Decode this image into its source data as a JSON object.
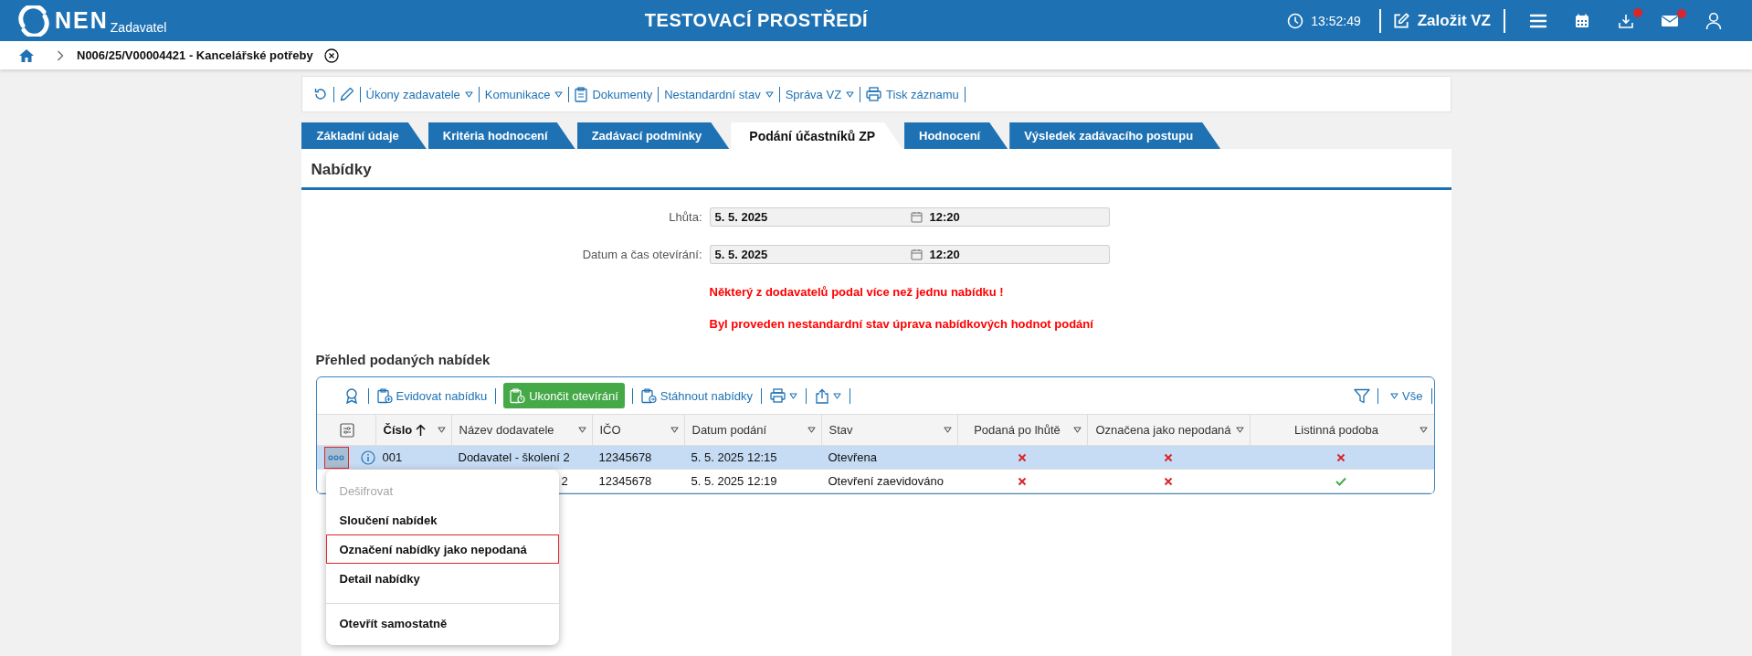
{
  "header": {
    "logo": "NEN",
    "logo_subtitle": "Zadavatel",
    "environment": "TESTOVACÍ PROSTŘEDÍ",
    "clock": "13:52:49",
    "create_button": "Založit VZ",
    "icons": [
      {
        "kind": "menu",
        "badge": false
      },
      {
        "kind": "calendar",
        "badge": false
      },
      {
        "kind": "download",
        "badge": true
      },
      {
        "kind": "mail",
        "badge": true
      },
      {
        "kind": "user",
        "badge": false
      }
    ]
  },
  "breadcrumb": {
    "title": "N006/25/V00004421 - Kancelářské potřeby"
  },
  "toolbar": [
    {
      "kind": "refresh",
      "dropdown": false
    },
    {
      "kind": "edit",
      "dropdown": false
    },
    {
      "kind": "text",
      "label": "Úkony zadavatele",
      "dropdown": true
    },
    {
      "kind": "text",
      "label": "Komunikace",
      "dropdown": true
    },
    {
      "kind": "documents",
      "label": "Dokumenty",
      "dropdown": false
    },
    {
      "kind": "text",
      "label": "Nestandardní stav",
      "dropdown": true
    },
    {
      "kind": "text",
      "label": "Správa VZ",
      "dropdown": true
    },
    {
      "kind": "print",
      "label": "Tisk záznamu",
      "dropdown": false
    }
  ],
  "tabs": [
    {
      "label": "Základní údaje",
      "selected": false
    },
    {
      "label": "Kritéria hodnocení",
      "selected": false
    },
    {
      "label": "Zadávací podmínky",
      "selected": false
    },
    {
      "label": "Podání účastníků ZP",
      "selected": true
    },
    {
      "label": "Hodnocení",
      "selected": false
    },
    {
      "label": "Výsledek zadávacího postupu",
      "selected": false
    }
  ],
  "section_title": "Nabídky",
  "fields": [
    {
      "label": "Lhůta:",
      "date": "5. 5. 2025",
      "time": "12:20"
    },
    {
      "label": "Datum a čas otevírání:",
      "date": "5. 5. 2025",
      "time": "12:20"
    }
  ],
  "messages": [
    "Některý z dodavatelů podal více než jednu nabídku !",
    "Byl proveden nestandardní stav úprava nabídkových hodnot podání"
  ],
  "offers": {
    "title": "Přehled podaných nabídek",
    "filter_label": "Vše",
    "toolbar": [
      {
        "kind": "award",
        "dropdown": false
      },
      {
        "kind": "register",
        "label": "Evidovat nabídku",
        "dropdown": false
      },
      {
        "kind": "primary",
        "label": "Ukončit otevírání",
        "dropdown": false
      },
      {
        "kind": "download",
        "label": "Stáhnout nabídky",
        "dropdown": false
      },
      {
        "kind": "print",
        "dropdown": true
      },
      {
        "kind": "export",
        "dropdown": true
      }
    ],
    "columns": [
      {
        "kind": "settings"
      },
      {
        "kind": "text",
        "label": "Číslo",
        "sort_ascending": true
      },
      {
        "kind": "text",
        "label": "Název dodavatele",
        "sort_ascending": false
      },
      {
        "kind": "text",
        "label": "IČO",
        "sort_ascending": false
      },
      {
        "kind": "text",
        "label": "Datum podání",
        "sort_ascending": false
      },
      {
        "kind": "text",
        "label": "Stav",
        "sort_ascending": false
      },
      {
        "kind": "flag",
        "label": "Podaná po lhůtě",
        "sort_ascending": false
      },
      {
        "kind": "flag",
        "label": "Označena jako nepodaná",
        "sort_ascending": false
      },
      {
        "kind": "flag",
        "label": "Listinná podoba",
        "sort_ascending": false
      }
    ],
    "rows": [
      {
        "selected": true,
        "cells": [
          {
            "kind": "actions",
            "highlighted": true
          },
          {
            "kind": "text",
            "text": "001"
          },
          {
            "kind": "text",
            "text": "Dodavatel - školení 2"
          },
          {
            "kind": "text",
            "text": "12345678"
          },
          {
            "kind": "text",
            "text": "5. 5. 2025 12:15"
          },
          {
            "kind": "text",
            "text": "Otevřena"
          },
          {
            "kind": "flag",
            "on": false
          },
          {
            "kind": "flag",
            "on": false
          },
          {
            "kind": "flag",
            "on": false
          }
        ]
      },
      {
        "selected": false,
        "cells": [
          {
            "kind": "hidden"
          },
          {
            "kind": "hidden"
          },
          {
            "kind": "text",
            "text": "2"
          },
          {
            "kind": "text",
            "text": "12345678"
          },
          {
            "kind": "text",
            "text": "5. 5. 2025 12:19"
          },
          {
            "kind": "text",
            "text": "Otevření zaevidováno"
          },
          {
            "kind": "flag",
            "on": false
          },
          {
            "kind": "flag",
            "on": false
          },
          {
            "kind": "flag",
            "on": true
          }
        ]
      }
    ]
  },
  "context_menu": {
    "items": [
      {
        "kind": "item",
        "label": "Dešifrovat",
        "disabled": true,
        "highlighted": false
      },
      {
        "kind": "item",
        "label": "Sloučení nabídek",
        "disabled": false,
        "highlighted": false
      },
      {
        "kind": "item",
        "label": "Označení nabídky jako nepodaná",
        "disabled": false,
        "highlighted": true
      },
      {
        "kind": "item",
        "label": "Detail nabídky",
        "disabled": false,
        "highlighted": false
      },
      {
        "kind": "divider"
      },
      {
        "kind": "item",
        "label": "Otevřít samostatně",
        "disabled": false,
        "highlighted": false
      }
    ]
  }
}
